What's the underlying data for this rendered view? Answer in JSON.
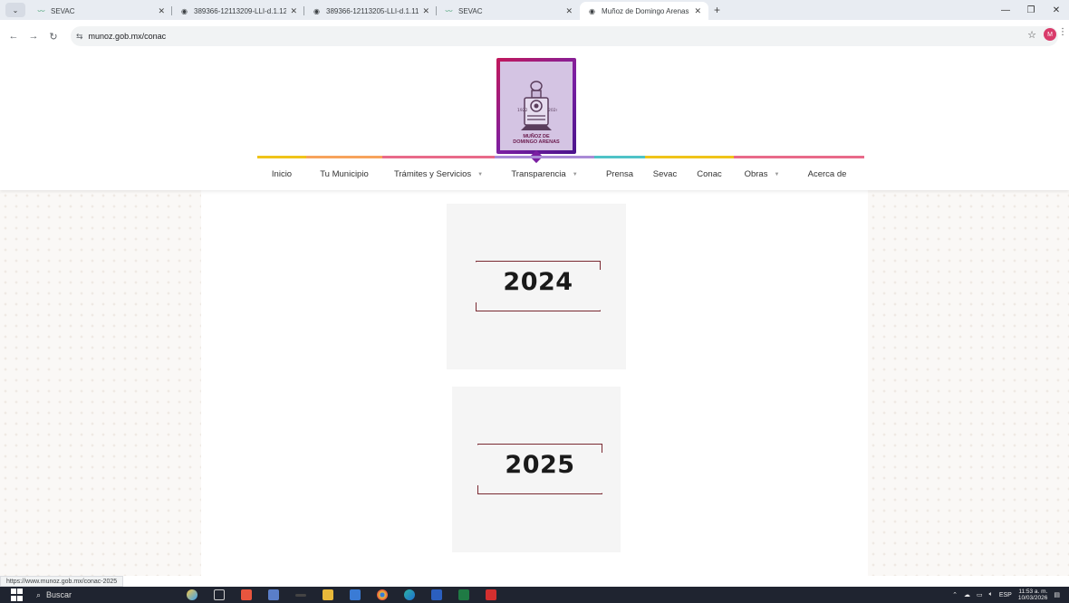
{
  "browser": {
    "tabs": [
      {
        "title": "SEVAC",
        "favicon": "sevac-icon",
        "active": false
      },
      {
        "title": "389366-12113209-LLI-d.1.12_...",
        "favicon": "globe-icon",
        "active": false
      },
      {
        "title": "389366-12113205-LLI-d.1.11_...",
        "favicon": "globe-icon",
        "active": false
      },
      {
        "title": "SEVAC",
        "favicon": "sevac-icon",
        "active": false
      },
      {
        "title": "Muñoz de Domingo Arenas",
        "favicon": "globe-icon",
        "active": true
      }
    ],
    "new_tab_label": "+",
    "url": "munoz.gob.mx/conac",
    "profile_initial": "M"
  },
  "site": {
    "logo_text_line1": "MUÑOZ DE",
    "logo_text_line2": "DOMINGO ARENAS",
    "logo_year_left": "1922",
    "logo_year_right": "2024",
    "nav": [
      {
        "label": "Inicio",
        "color": "#f0c419",
        "dropdown": false
      },
      {
        "label": "Tu Municipio",
        "color": "#f7a35c",
        "dropdown": false
      },
      {
        "label": "Trámites y Servicios",
        "color": "#e86a8a",
        "dropdown": true
      },
      {
        "label": "Transparencia",
        "color": "#a98bd6",
        "dropdown": true
      },
      {
        "label": "Prensa",
        "color": "#4fc3c7",
        "dropdown": false
      },
      {
        "label": "Sevac",
        "color": "#f0c419",
        "dropdown": false
      },
      {
        "label": "Conac",
        "color": "#f0c419",
        "dropdown": false
      },
      {
        "label": "Obras",
        "color": "#e86a8a",
        "dropdown": true
      },
      {
        "label": "Acerca de",
        "color": "#e86a8a",
        "dropdown": false
      }
    ],
    "years": [
      "2024",
      "2025"
    ]
  },
  "status_bar": {
    "hover_url": "https://www.munoz.gob.mx/conac-2025"
  },
  "taskbar": {
    "search_placeholder": "Buscar",
    "language": "ESP",
    "time": "11:53 a. m.",
    "date": "10/03/2026"
  }
}
